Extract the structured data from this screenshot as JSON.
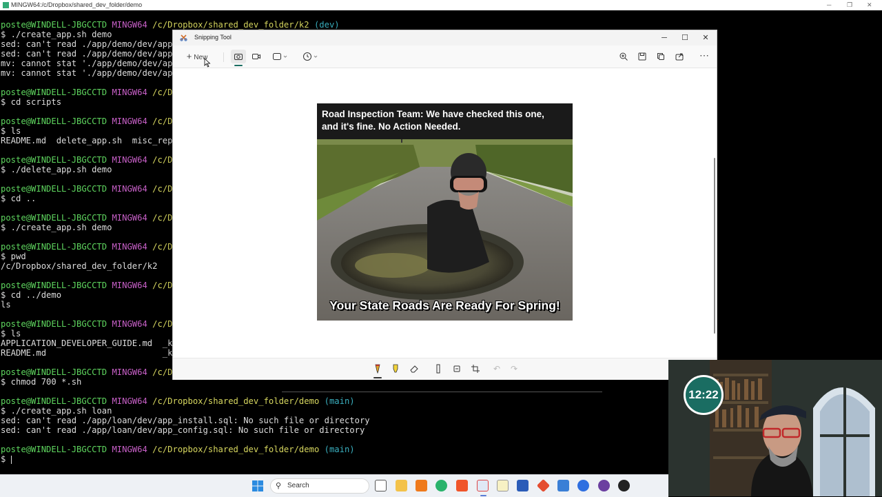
{
  "terminal": {
    "title": "MINGW64:/c/Dropbox/shared_dev_folder/demo",
    "lines": [
      [
        {
          "t": "poste@WINDELL-JBGCCTD ",
          "c": "green"
        },
        {
          "t": "MINGW64 ",
          "c": "mag"
        },
        {
          "t": "/c/Dropbox/shared_dev_folder/k2 ",
          "c": "yel"
        },
        {
          "t": "(dev)",
          "c": "cyan"
        }
      ],
      [
        {
          "t": "$ ./create_app.sh demo",
          "c": ""
        }
      ],
      [
        {
          "t": "sed: can't read ./app/demo/dev/app",
          "c": ""
        }
      ],
      [
        {
          "t": "sed: can't read ./app/demo/dev/app",
          "c": ""
        }
      ],
      [
        {
          "t": "mv: cannot stat './app/demo/dev/ap",
          "c": ""
        }
      ],
      [
        {
          "t": "mv: cannot stat './app/demo/dev/ap",
          "c": ""
        }
      ],
      [],
      [
        {
          "t": "poste@WINDELL-JBGCCTD ",
          "c": "green"
        },
        {
          "t": "MINGW64 ",
          "c": "mag"
        },
        {
          "t": "/c/D",
          "c": "yel"
        }
      ],
      [
        {
          "t": "$ cd scripts",
          "c": ""
        }
      ],
      [],
      [
        {
          "t": "poste@WINDELL-JBGCCTD ",
          "c": "green"
        },
        {
          "t": "MINGW64 ",
          "c": "mag"
        },
        {
          "t": "/c/D",
          "c": "yel"
        }
      ],
      [
        {
          "t": "$ ls",
          "c": ""
        }
      ],
      [
        {
          "t": "README.md  delete_app.sh  misc_rep",
          "c": ""
        }
      ],
      [],
      [
        {
          "t": "poste@WINDELL-JBGCCTD ",
          "c": "green"
        },
        {
          "t": "MINGW64 ",
          "c": "mag"
        },
        {
          "t": "/c/D",
          "c": "yel"
        }
      ],
      [
        {
          "t": "$ ./delete_app.sh demo",
          "c": ""
        }
      ],
      [],
      [
        {
          "t": "poste@WINDELL-JBGCCTD ",
          "c": "green"
        },
        {
          "t": "MINGW64 ",
          "c": "mag"
        },
        {
          "t": "/c/D",
          "c": "yel"
        }
      ],
      [
        {
          "t": "$ cd ..",
          "c": ""
        }
      ],
      [],
      [
        {
          "t": "poste@WINDELL-JBGCCTD ",
          "c": "green"
        },
        {
          "t": "MINGW64 ",
          "c": "mag"
        },
        {
          "t": "/c/D",
          "c": "yel"
        }
      ],
      [
        {
          "t": "$ ./create_app.sh demo",
          "c": ""
        }
      ],
      [],
      [
        {
          "t": "poste@WINDELL-JBGCCTD ",
          "c": "green"
        },
        {
          "t": "MINGW64 ",
          "c": "mag"
        },
        {
          "t": "/c/D",
          "c": "yel"
        }
      ],
      [
        {
          "t": "$ pwd",
          "c": ""
        }
      ],
      [
        {
          "t": "/c/Dropbox/shared_dev_folder/k2",
          "c": ""
        }
      ],
      [],
      [
        {
          "t": "poste@WINDELL-JBGCCTD ",
          "c": "green"
        },
        {
          "t": "MINGW64 ",
          "c": "mag"
        },
        {
          "t": "/c/D",
          "c": "yel"
        }
      ],
      [
        {
          "t": "$ cd ../demo",
          "c": ""
        }
      ],
      [
        {
          "t": "ls",
          "c": ""
        }
      ],
      [],
      [
        {
          "t": "poste@WINDELL-JBGCCTD ",
          "c": "green"
        },
        {
          "t": "MINGW64 ",
          "c": "mag"
        },
        {
          "t": "/c/D",
          "c": "yel"
        }
      ],
      [
        {
          "t": "$ ls",
          "c": ""
        }
      ],
      [
        {
          "t": "APPLICATION_DEVELOPER_GUIDE.md  _k",
          "c": ""
        }
      ],
      [
        {
          "t": "README.md                       _k",
          "c": ""
        }
      ],
      [],
      [
        {
          "t": "poste@WINDELL-JBGCCTD ",
          "c": "green"
        },
        {
          "t": "MINGW64 ",
          "c": "mag"
        },
        {
          "t": "/c/D",
          "c": "yel"
        }
      ],
      [
        {
          "t": "$ chmod 700 *.sh",
          "c": ""
        }
      ],
      [],
      [
        {
          "t": "poste@WINDELL-JBGCCTD ",
          "c": "green"
        },
        {
          "t": "MINGW64 ",
          "c": "mag"
        },
        {
          "t": "/c/Dropbox/shared_dev_folder/demo ",
          "c": "yel"
        },
        {
          "t": "(main)",
          "c": "cyan"
        }
      ],
      [
        {
          "t": "$ ./create_app.sh loan",
          "c": ""
        }
      ],
      [
        {
          "t": "sed: can't read ./app/loan/dev/app_install.sql: No such file or directory",
          "c": ""
        }
      ],
      [
        {
          "t": "sed: can't read ./app/loan/dev/app_config.sql: No such file or directory",
          "c": ""
        }
      ],
      [],
      [
        {
          "t": "poste@WINDELL-JBGCCTD ",
          "c": "green"
        },
        {
          "t": "MINGW64 ",
          "c": "mag"
        },
        {
          "t": "/c/Dropbox/shared_dev_folder/demo ",
          "c": "yel"
        },
        {
          "t": "(main)",
          "c": "cyan"
        }
      ],
      [
        {
          "t": "$ ",
          "c": ""
        }
      ]
    ]
  },
  "snipping_tool": {
    "title": "Snipping Tool",
    "window_controls": [
      "─",
      "☐",
      "✕"
    ],
    "toolbar": {
      "new_label": "New",
      "icons": [
        "camera-icon",
        "video-icon",
        "rectangle-mode-icon",
        "delay-timer-icon",
        "zoom-icon",
        "save-icon",
        "copy-icon",
        "share-icon",
        "more-options-icon"
      ]
    },
    "markup_tools": [
      "ballpoint-pen-icon",
      "highlighter-icon",
      "eraser-icon",
      "ruler-icon",
      "text-actions-icon",
      "crop-icon",
      "undo-icon",
      "redo-icon"
    ],
    "meme": {
      "top_line_1": "Road Inspection Team: We have checked this one,",
      "top_line_2": "and it's fine. No Action Needed.",
      "bottom_caption": "Your State Roads Are Ready For Spring!"
    }
  },
  "webcam": {
    "clock": "12:22"
  },
  "taskbar": {
    "search_label": "Search",
    "apps": [
      "task-view-icon",
      "file-explorer-icon",
      "sublime-text-icon",
      "chrome-icon",
      "brave-icon",
      "snipping-tool-icon",
      "notepad-icon",
      "word-icon",
      "git-icon",
      "rdp-icon",
      "signal-icon",
      "obs-icon",
      "github-icon"
    ],
    "colors": {
      "accent": "#5a7cd6",
      "meme_text": "#ffffff",
      "clock_bg": "#1a6d62"
    }
  }
}
